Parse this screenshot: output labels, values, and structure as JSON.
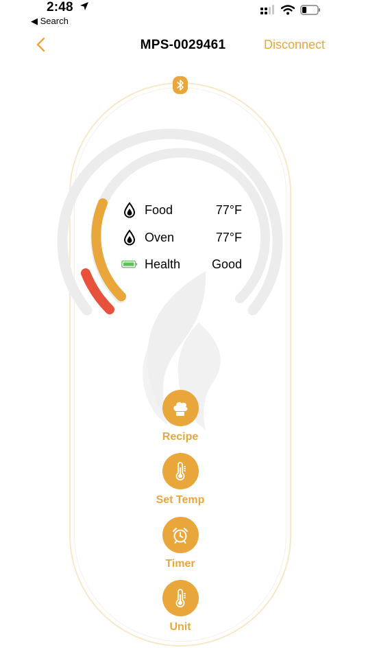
{
  "status_bar": {
    "time": "2:48",
    "back_label": "◀ Search"
  },
  "nav": {
    "title": "MPS-0029461",
    "disconnect_label": "Disconnect"
  },
  "readings": [
    {
      "label": "Food",
      "value": "77°F",
      "icon": "drop-icon"
    },
    {
      "label": "Oven",
      "value": "77°F",
      "icon": "drop-icon"
    },
    {
      "label": "Health",
      "value": "Good",
      "icon": "battery-icon"
    }
  ],
  "actions": [
    {
      "label": "Recipe",
      "icon": "chef-hat-icon"
    },
    {
      "label": "Set Temp",
      "icon": "thermometer-icon"
    },
    {
      "label": "Timer",
      "icon": "alarm-clock-icon"
    },
    {
      "label": "Unit",
      "icon": "thermometer-icon"
    }
  ],
  "colors": {
    "accent": "#e9a63a",
    "danger": "#e8513b",
    "battery": "#5cc15a"
  }
}
